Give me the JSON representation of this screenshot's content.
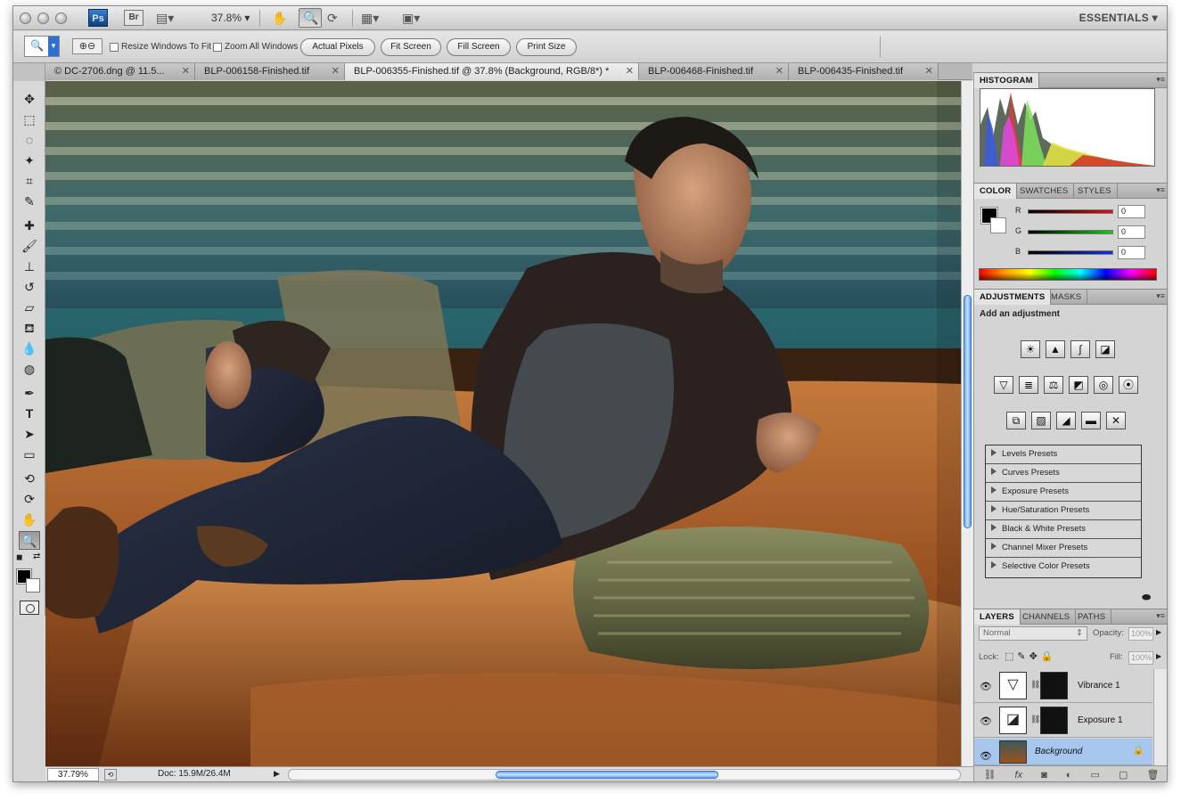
{
  "appbar": {
    "ps_logo": "Ps",
    "br_logo": "Br",
    "zoom_level": "37.8%",
    "workspace": "ESSENTIALS"
  },
  "options": {
    "resize_windows": "Resize Windows To Fit",
    "zoom_all": "Zoom All Windows",
    "actual_pixels": "Actual Pixels",
    "fit_screen": "Fit Screen",
    "fill_screen": "Fill Screen",
    "print_size": "Print Size"
  },
  "tabs": [
    {
      "label": "© DC-2706.dng @ 11.5..."
    },
    {
      "label": "BLP-006158-Finished.tif"
    },
    {
      "label": "BLP-006355-Finished.tif @ 37.8% (Background, RGB/8*) *"
    },
    {
      "label": "BLP-006468-Finished.tif"
    },
    {
      "label": "BLP-006435-Finished.tif"
    }
  ],
  "status": {
    "zoom": "37.79%",
    "doc": "Doc: 15.9M/26.4M"
  },
  "panels": {
    "histogram_tab": "HISTOGRAM",
    "color_tabs": [
      "COLOR",
      "SWATCHES",
      "STYLES"
    ],
    "color": {
      "r_label": "R",
      "g_label": "G",
      "b_label": "B",
      "r_value": "0",
      "g_value": "0",
      "b_value": "0"
    },
    "adjust_tabs": [
      "ADJUSTMENTS",
      "MASKS"
    ],
    "add_adjustment": "Add an adjustment",
    "presets": [
      "Levels Presets",
      "Curves Presets",
      "Exposure Presets",
      "Hue/Saturation Presets",
      "Black & White Presets",
      "Channel Mixer Presets",
      "Selective Color Presets"
    ],
    "layer_tabs": [
      "LAYERS",
      "CHANNELS",
      "PATHS"
    ],
    "blend_mode": "Normal",
    "opacity_label": "Opacity:",
    "opacity_value": "100%",
    "lock_label": "Lock:",
    "fill_label": "Fill:",
    "fill_value": "100%",
    "layers": [
      {
        "name": "Vibrance 1"
      },
      {
        "name": "Exposure 1"
      },
      {
        "name": "Background"
      }
    ]
  },
  "colors": {
    "accent": "#2d6fd2",
    "selected_layer": "#a7c7ee"
  }
}
